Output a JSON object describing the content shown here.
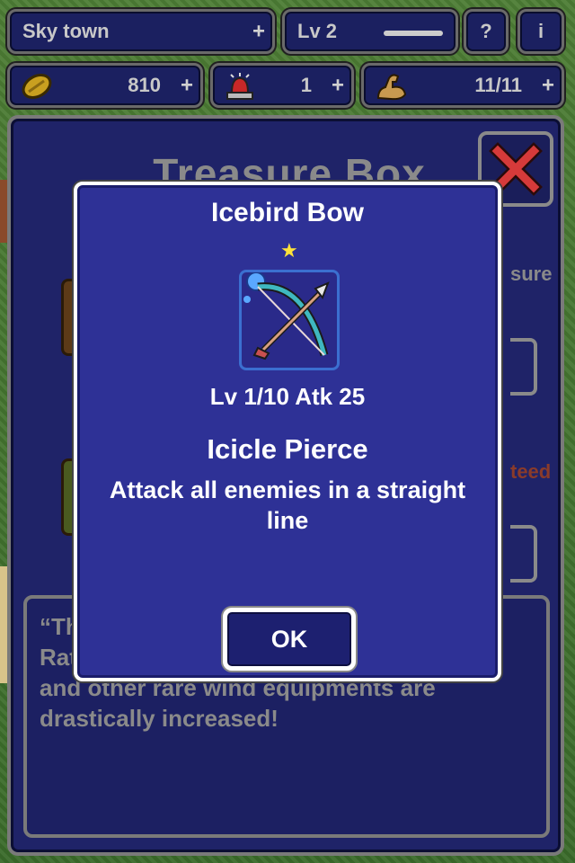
{
  "status": {
    "town": "Sky town",
    "level": "Lv 2",
    "help_label": "?",
    "info_label": "i",
    "gold": "810",
    "bells": "1",
    "stamina": "11/11",
    "plus": "+"
  },
  "panel": {
    "title": "Treasure Box",
    "side_treasure": "sure",
    "side_guaranteed": "teed",
    "description_lines": [
      "“Th",
      "Rat",
      "and other rare wind equipments are",
      "drastically increased!"
    ]
  },
  "modal": {
    "item_name": "Icebird Bow",
    "rarity_stars": 1,
    "stats": "Lv 1/10 Atk 25",
    "skill_name": "Icicle Pierce",
    "skill_description": "Attack all enemies in a straight line",
    "ok_label": "OK",
    "icon": "bow-and-arrow-icon"
  },
  "colors": {
    "modal_bg": "#2e3196",
    "star": "#ffe23a",
    "close_x": "#d63a3a",
    "gold": "#c9a020"
  }
}
